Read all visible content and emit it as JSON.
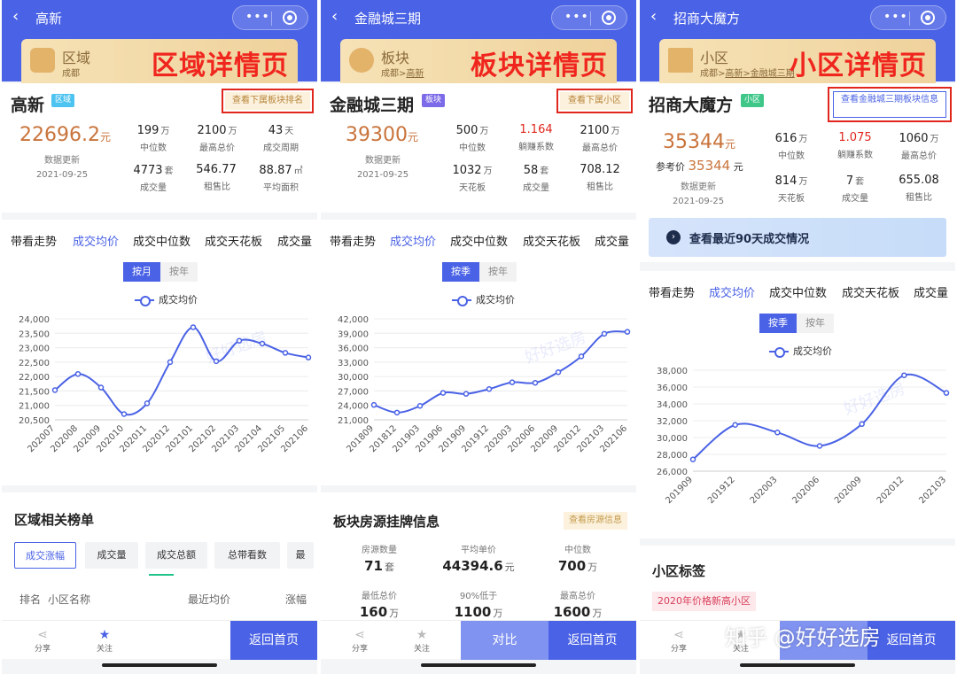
{
  "colors": {
    "primary": "#4a62e5",
    "accent_red": "#e0261d",
    "price_orange": "#c9743c",
    "up_red": "#e0261d"
  },
  "panels": [
    {
      "header": {
        "title": "高新"
      },
      "banner": {
        "kind": "区域",
        "path": "成都",
        "headline": "区域详情页"
      },
      "card": {
        "name": "高新",
        "tag": "区域",
        "link": "查看下属板块排名",
        "price": "22696.2",
        "price_unit": "元",
        "update_label": "数据更新",
        "update_date": "2021-09-25",
        "stats": [
          {
            "value": "199",
            "unit": "万",
            "label": "中位数"
          },
          {
            "value": "2100",
            "unit": "万",
            "label": "最高总价"
          },
          {
            "value": "43",
            "unit": "天",
            "label": "成交周期"
          },
          {
            "value": "4773",
            "unit": "套",
            "label": "成交量"
          },
          {
            "value": "546.77",
            "unit": "",
            "label": "租售比"
          },
          {
            "value": "88.87",
            "unit": "㎡",
            "label": "平均面积"
          }
        ]
      },
      "tabs": [
        "带看走势",
        "成交均价",
        "成交中位数",
        "成交天花板",
        "成交量"
      ],
      "active_tab": 1,
      "toggle": [
        "按月",
        "按年"
      ],
      "legend": "成交均价",
      "watermark": "好好选房",
      "section": {
        "title": "区域相关榜单",
        "pills": [
          "成交涨幅",
          "成交量",
          "成交总额",
          "总带看数",
          "最"
        ],
        "table_headers": [
          "排名",
          "小区名称",
          "最近均价",
          "涨幅"
        ]
      },
      "bottom": {
        "share": "分享",
        "follow": "关注",
        "home": "返回首页"
      }
    },
    {
      "header": {
        "title": "金融城三期"
      },
      "banner": {
        "kind": "板块",
        "path_parts": [
          "成都>",
          "高新"
        ],
        "headline": "板块详情页"
      },
      "card": {
        "name": "金融城三期",
        "tag": "板块",
        "link": "查看下属小区",
        "price": "39300",
        "price_unit": "元",
        "update_label": "数据更新",
        "update_date": "2021-09-25",
        "stats": [
          {
            "value": "500",
            "unit": "万",
            "label": "中位数"
          },
          {
            "value": "1.164",
            "unit": "",
            "label": "躺赚系数"
          },
          {
            "value": "2100",
            "unit": "万",
            "label": "最高总价"
          },
          {
            "value": "1032",
            "unit": "万",
            "label": "天花板"
          },
          {
            "value": "58",
            "unit": "套",
            "label": "成交量"
          },
          {
            "value": "708.12",
            "unit": "",
            "label": "租售比"
          }
        ]
      },
      "tabs": [
        "带看走势",
        "成交均价",
        "成交中位数",
        "成交天花板",
        "成交量"
      ],
      "active_tab": 1,
      "toggle": [
        "按季",
        "按年"
      ],
      "legend": "成交均价",
      "watermark": "好好选房",
      "section": {
        "title": "板块房源挂牌信息",
        "badge": "查看房源信息",
        "items": [
          {
            "label": "房源数量",
            "value": "71",
            "unit": "套"
          },
          {
            "label": "平均单价",
            "value": "44394.6",
            "unit": "元"
          },
          {
            "label": "中位数",
            "value": "700",
            "unit": "万"
          },
          {
            "label": "最低总价",
            "value": "160",
            "unit": "万"
          },
          {
            "label": "90%低于",
            "value": "1100",
            "unit": "万"
          },
          {
            "label": "最高总价",
            "value": "1600",
            "unit": "万"
          }
        ]
      },
      "bottom": {
        "share": "分享",
        "follow": "关注",
        "compare": "对比",
        "home": "返回首页"
      }
    },
    {
      "header": {
        "title": "招商大魔方"
      },
      "banner": {
        "kind": "小区",
        "path_parts": [
          "成都>",
          "高新>",
          "金融城三期"
        ],
        "headline": "小区详情页"
      },
      "card": {
        "name": "招商大魔方",
        "tag": "小区",
        "link": "查看金融城三期板块信息",
        "price": "35344",
        "price_unit": "元",
        "ref_label": "参考价",
        "ref_price": "35344",
        "update_label": "数据更新",
        "update_date": "2021-09-25",
        "stats": [
          {
            "value": "616",
            "unit": "万",
            "label": "中位数"
          },
          {
            "value": "1.075",
            "unit": "",
            "label": "躺赚系数"
          },
          {
            "value": "1060",
            "unit": "万",
            "label": "最高总价"
          },
          {
            "value": "814",
            "unit": "万",
            "label": "天花板"
          },
          {
            "value": "7",
            "unit": "套",
            "label": "成交量"
          },
          {
            "value": "655.08",
            "unit": "",
            "label": "租售比"
          }
        ]
      },
      "notice": "查看最近90天成交情况",
      "tabs": [
        "带看走势",
        "成交均价",
        "成交中位数",
        "成交天花板",
        "成交量"
      ],
      "active_tab": 1,
      "toggle": [
        "按季",
        "按年"
      ],
      "legend": "成交均价",
      "watermark": "好好选房",
      "section": {
        "title": "小区标签",
        "tag": "2020年价格新高小区"
      },
      "bottom": {
        "share": "分享",
        "follow": "关注",
        "home": "返回首页"
      }
    }
  ],
  "page_watermark": "知乎 @好好选房",
  "chart_data": [
    {
      "type": "line",
      "series": [
        {
          "name": "成交均价",
          "values": [
            21530,
            22090,
            21620,
            20700,
            21070,
            22500,
            23710,
            22530,
            23240,
            23140,
            22820,
            22660
          ]
        }
      ],
      "categories": [
        "202007",
        "202008",
        "202009",
        "202010",
        "202011",
        "202012",
        "202101",
        "202102",
        "202103",
        "202104",
        "202105",
        "202106"
      ],
      "ylim": [
        20500,
        24000
      ],
      "yticks": [
        20500,
        21000,
        21500,
        22000,
        22500,
        23000,
        23500,
        24000
      ]
    },
    {
      "type": "line",
      "series": [
        {
          "name": "成交均价",
          "values": [
            24100,
            22500,
            23900,
            26600,
            26400,
            27400,
            28800,
            28700,
            30900,
            34200,
            38900,
            39300
          ]
        }
      ],
      "categories": [
        "201809",
        "201812",
        "201903",
        "201906",
        "201909",
        "201912",
        "202003",
        "202006",
        "202009",
        "202012",
        "202103",
        "202106"
      ],
      "ylim": [
        21000,
        42000
      ],
      "yticks": [
        21000,
        24000,
        27000,
        30000,
        33000,
        36000,
        39000,
        42000
      ]
    },
    {
      "type": "line",
      "series": [
        {
          "name": "成交均价",
          "values": [
            27400,
            31500,
            30600,
            29000,
            31600,
            37400,
            35300
          ]
        }
      ],
      "categories": [
        "201909",
        "201912",
        "202003",
        "202006",
        "202009",
        "202012",
        "202103"
      ],
      "ylim": [
        26000,
        38000
      ],
      "yticks": [
        26000,
        28000,
        30000,
        32000,
        34000,
        36000,
        38000
      ]
    }
  ]
}
